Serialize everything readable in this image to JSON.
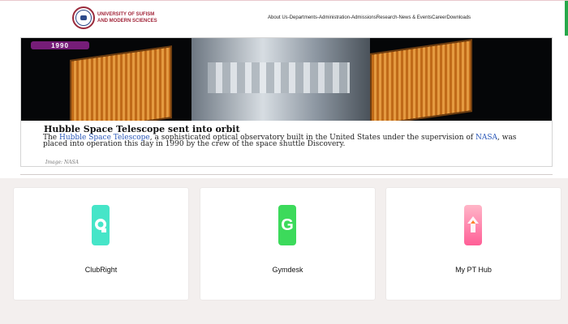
{
  "header": {
    "logo_line1": "UNIVERSITY OF SUFISM",
    "logo_line2": "AND MODERN SCIENCES",
    "nav": [
      "About Us",
      "Departments",
      "Administration",
      "Admissions",
      "Research",
      "News & Events",
      "Career",
      "Downloads"
    ],
    "separator": " -"
  },
  "news": {
    "year_badge": "1990",
    "title": "Hubble Space Telescope sent into orbit",
    "text_before": "The ",
    "link1": "Hubble Space Telescope",
    "text_middle1": ", a sophisticated optical observatory built in the United States under the supervision of ",
    "link2": "NASA",
    "text_after": ", was placed into operation this day in 1990 by the crew of the space shuttle Discovery.",
    "credit": "Image: NASA"
  },
  "apps": [
    {
      "name": "ClubRight",
      "color": "#46e5c8",
      "icon": "clubright-logo-icon"
    },
    {
      "name": "Gymdesk",
      "color": "#3cda5b",
      "icon": "gymdesk-logo-icon"
    },
    {
      "name": "My PT Hub",
      "color": "#ff5f97",
      "icon": "mypthub-logo-icon"
    }
  ]
}
